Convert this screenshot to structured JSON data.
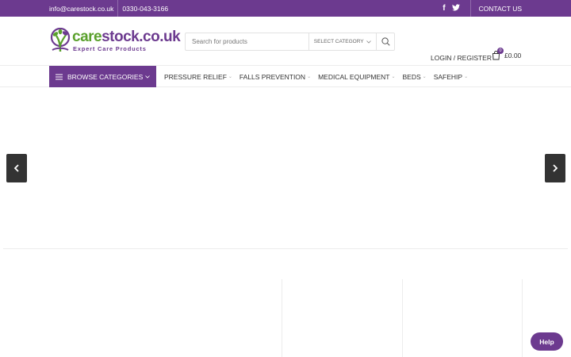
{
  "topbar": {
    "email": "info@carestock.co.uk",
    "phone": "0330-043-3166",
    "social_icons": [
      "facebook-icon",
      "twitter-icon"
    ],
    "contact_label": "CONTACT US"
  },
  "logo": {
    "brand_part1": "care",
    "brand_part2": "stock.co.uk",
    "tagline": "Expert Care Products"
  },
  "search": {
    "placeholder": "Search for products",
    "category_label": "SELECT CATEGORY"
  },
  "account": {
    "login_label": "LOGIN / REGISTER"
  },
  "cart": {
    "count": "0",
    "total": "£0.00"
  },
  "nav": {
    "browse_label": "BROWSE CATEGORIES",
    "items": [
      {
        "label": "PRESSURE RELIEF"
      },
      {
        "label": "FALLS PREVENTION"
      },
      {
        "label": "MEDICAL EQUIPMENT"
      },
      {
        "label": "BEDS"
      },
      {
        "label": "SAFEHIP"
      }
    ]
  },
  "help": {
    "label": "Help"
  },
  "colors": {
    "brand_purple": "#6c3a8f",
    "brand_green": "#5aa02c",
    "slider_arrow": "#333333"
  }
}
